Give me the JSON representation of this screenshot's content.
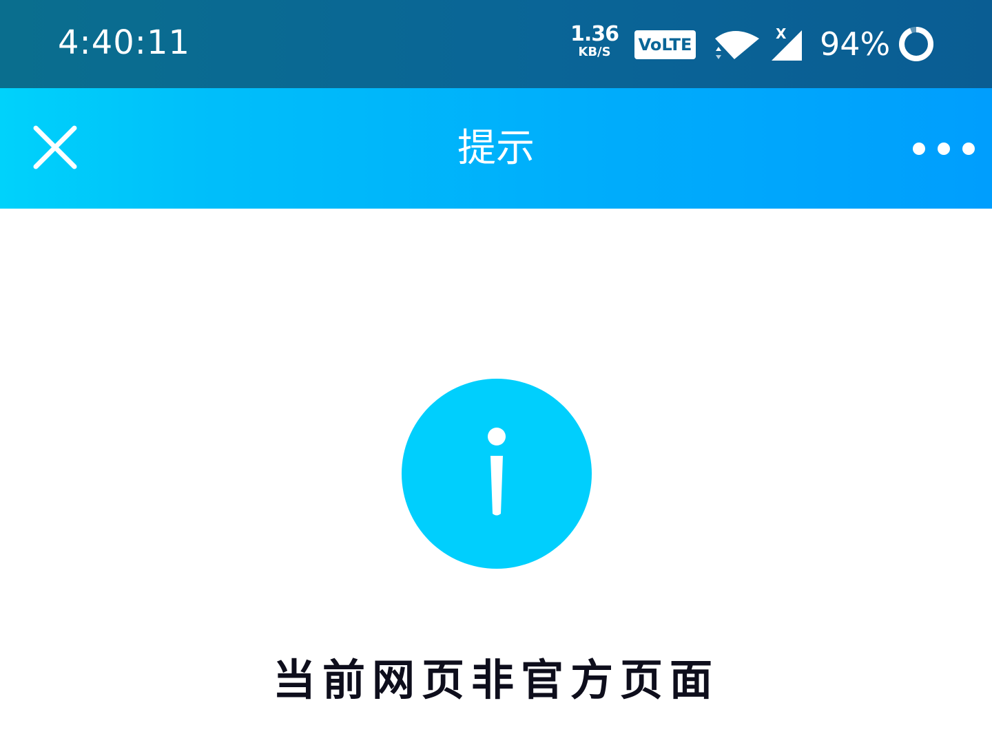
{
  "status_bar": {
    "time": "4:40:11",
    "net_speed_value": "1.36",
    "net_speed_unit": "KB/S",
    "volte_label": "VoLTE",
    "signal_badge": "X",
    "battery_percent": "94%",
    "battery_level": 0.94,
    "icons": [
      "wifi-icon",
      "signal-icon",
      "battery-icon"
    ]
  },
  "title_bar": {
    "title": "提示",
    "close_icon": "close-icon",
    "more_icon": "more-icon"
  },
  "content": {
    "icon": "info-icon",
    "message": "当前网页非官方页面"
  },
  "colors": {
    "status_bar": "#0a6597",
    "title_bar_start": "#00d2fb",
    "title_bar_end": "#009efd",
    "info_icon": "#00cffd",
    "message_text": "#0e0e1c"
  }
}
